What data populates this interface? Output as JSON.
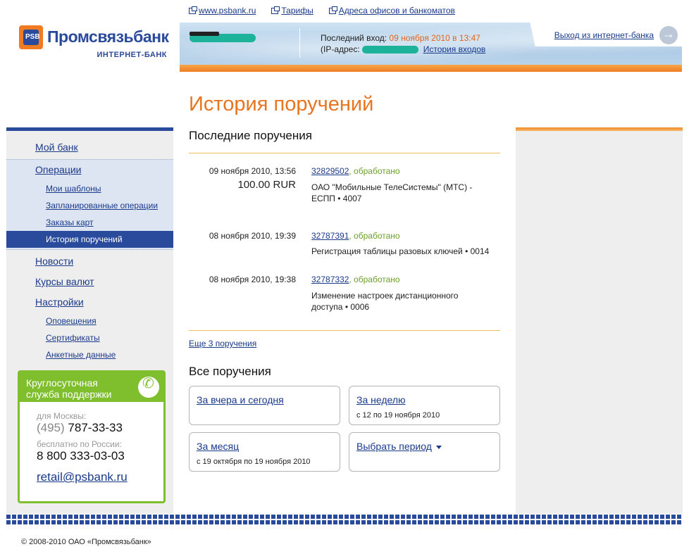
{
  "top_links": [
    {
      "label": "www.psbank.ru"
    },
    {
      "label": "Тарифы"
    },
    {
      "label": "Адреса офисов и банкоматов"
    }
  ],
  "logo": {
    "mark": "PSB",
    "name": "Промсвязьбанк",
    "sub": "ИНТЕРНЕТ-БАНК"
  },
  "header": {
    "last_login_label": "Последний вход:",
    "last_login_date": "09 ноября 2010 в 13:47",
    "ip_label": "(IP-адрес:",
    "login_history_link": "История входов",
    "logout_link": "Выход из интернет-банка"
  },
  "page_title": "История поручений",
  "nav": {
    "my_bank": "Мой банк",
    "operations": "Операции",
    "templates": "Мои шаблоны",
    "scheduled": "Запланированные операции",
    "card_orders": "Заказы карт",
    "history": "История поручений",
    "news": "Новости",
    "rates": "Курсы валют",
    "settings": "Настройки",
    "notifications": "Оповещения",
    "certificates": "Сертификаты",
    "profile": "Анкетные данные"
  },
  "support": {
    "title_line1": "Круглосуточная",
    "title_line2": "служба поддержки",
    "moscow_label": "для Москвы:",
    "moscow_code": "(495)",
    "moscow_number": "787-33-33",
    "russia_label": "бесплатно по России:",
    "russia_number": "8 800 333-03-03",
    "email": "retail@psbank.ru"
  },
  "recent": {
    "heading": "Последние поручения",
    "orders": [
      {
        "datetime": "09 ноября 2010, 13:56",
        "amount": "100.00 RUR",
        "number": "32829502",
        "status": ", обработано",
        "desc": "ОАО \"Мобильные ТелеСистемы\" (МТС) - ЕСПП • 4007"
      },
      {
        "datetime": "08 ноября 2010, 19:39",
        "amount": "",
        "number": "32787391",
        "status": ", обработано",
        "desc": "Регистрация таблицы разовых ключей • 0014"
      },
      {
        "datetime": "08 ноября 2010, 19:38",
        "amount": "",
        "number": "32787332",
        "status": ", обработано",
        "desc": "Изменение настроек дистанционного доступа • 0006"
      }
    ],
    "more_link": "Еще 3 поручения"
  },
  "all": {
    "heading": "Все поручения",
    "cards": [
      {
        "title": "За вчера и сегодня",
        "sub": ""
      },
      {
        "title": "За неделю",
        "sub": "с 12 по 19 ноября 2010"
      },
      {
        "title": "За месяц",
        "sub": "с 19 октября по 19 ноября 2010"
      },
      {
        "title": "Выбрать период",
        "sub": ""
      }
    ]
  },
  "footer": "© 2008-2010 ОАО «Промсвязьбанк»",
  "colors": {
    "brand_blue": "#2a4a9b",
    "brand_orange": "#e8751f",
    "support_green": "#7fbf2e",
    "status_green": "#6aa02a"
  }
}
